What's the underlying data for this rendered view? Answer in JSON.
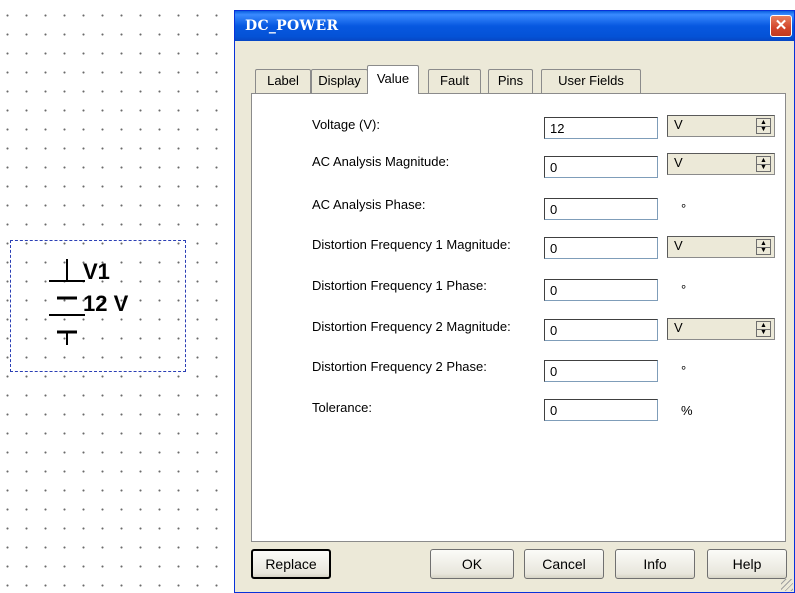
{
  "schematic": {
    "component": {
      "ref_id": "V1",
      "value_label": "12 V"
    }
  },
  "dialog": {
    "title": "DC_POWER",
    "close_glyph": "✕",
    "tabs": [
      {
        "label": "Label"
      },
      {
        "label": "Display"
      },
      {
        "label": "Value",
        "active": true
      },
      {
        "label": "Fault"
      },
      {
        "label": "Pins"
      },
      {
        "label": "User Fields"
      }
    ],
    "fields": [
      {
        "label": "Voltage (V):",
        "value": "12",
        "unit": "V",
        "unit_type": "dropdown"
      },
      {
        "label": "AC Analysis Magnitude:",
        "value": "0",
        "unit": "V",
        "unit_type": "dropdown"
      },
      {
        "label": "AC Analysis Phase:",
        "value": "0",
        "unit": "°",
        "unit_type": "text"
      },
      {
        "label": "Distortion Frequency 1 Magnitude:",
        "value": "0",
        "unit": "V",
        "unit_type": "dropdown"
      },
      {
        "label": "Distortion Frequency 1 Phase:",
        "value": "0",
        "unit": "°",
        "unit_type": "text"
      },
      {
        "label": "Distortion Frequency 2 Magnitude:",
        "value": "0",
        "unit": "V",
        "unit_type": "dropdown"
      },
      {
        "label": "Distortion Frequency 2 Phase:",
        "value": "0",
        "unit": "°",
        "unit_type": "text"
      },
      {
        "label": "Tolerance:",
        "value": "0",
        "unit": "%",
        "unit_type": "text"
      }
    ],
    "buttons": {
      "replace": "Replace",
      "ok": "OK",
      "cancel": "Cancel",
      "info": "Info",
      "help": "Help"
    },
    "colors": {
      "title_bar": "#0758e0",
      "dialog_bg": "#ece9d8",
      "close_button": "#d2452a",
      "selection_border": "#2b3fb5"
    }
  }
}
